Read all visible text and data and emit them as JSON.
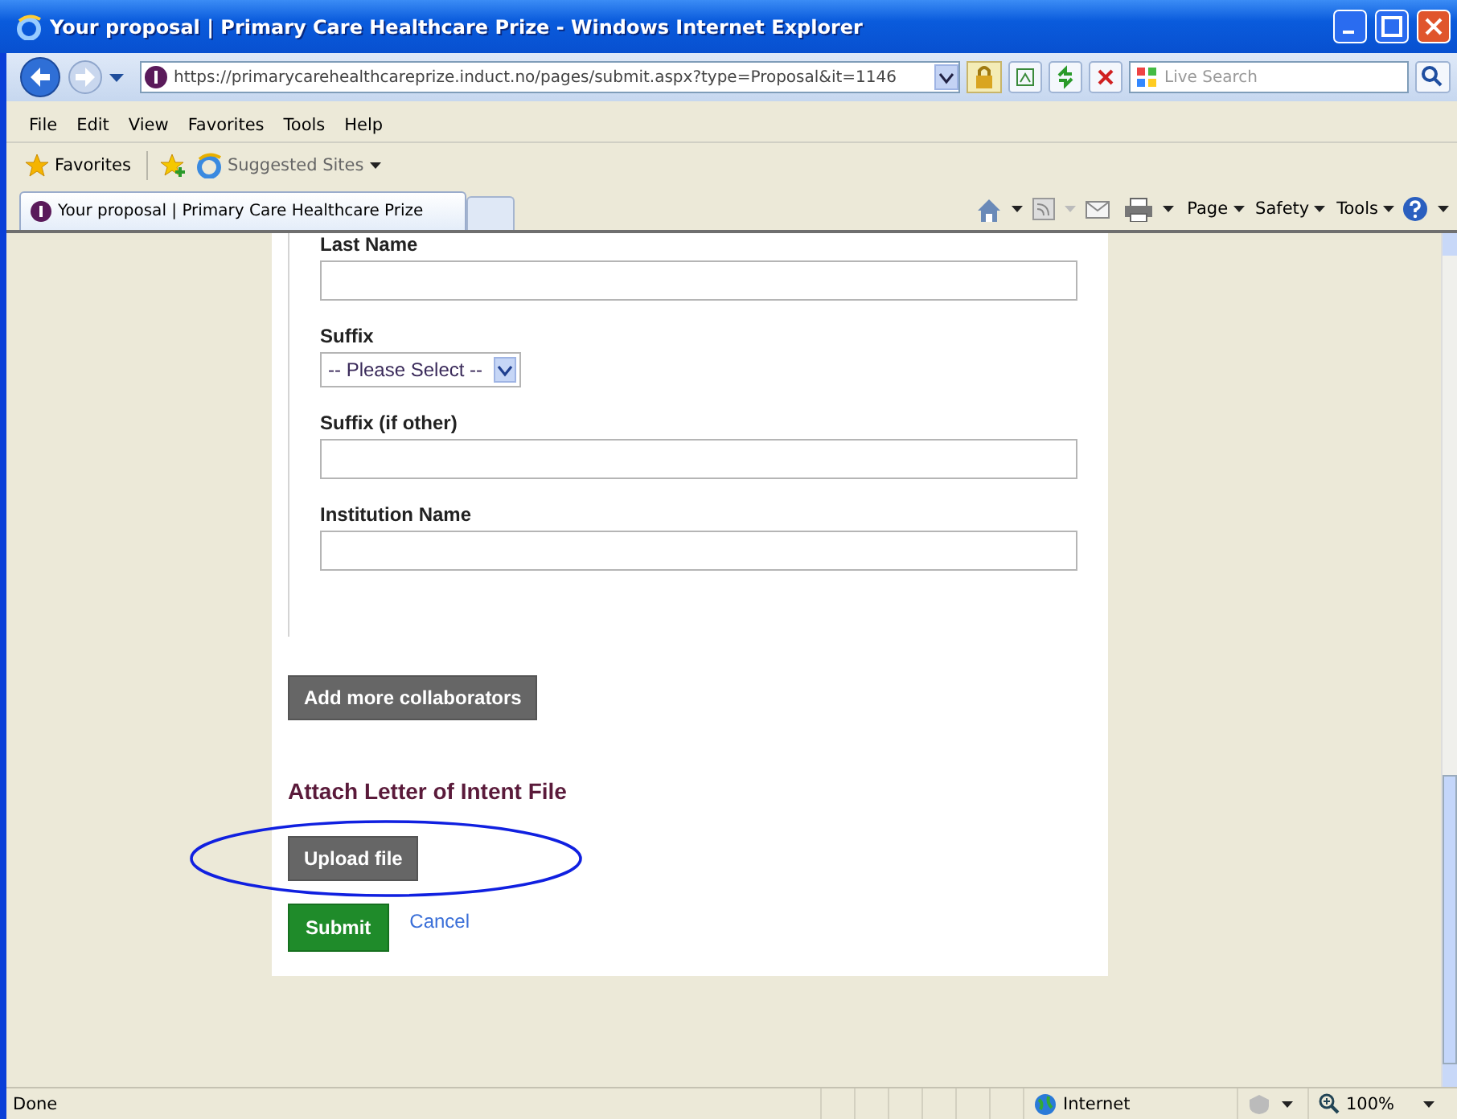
{
  "window": {
    "title": "Your proposal | Primary Care Healthcare Prize - Windows Internet Explorer"
  },
  "address_bar": {
    "url": "https://primarycarehealthcareprize.induct.no/pages/submit.aspx?type=Proposal&it=1146"
  },
  "search": {
    "placeholder": "Live Search"
  },
  "menu": [
    "File",
    "Edit",
    "View",
    "Favorites",
    "Tools",
    "Help"
  ],
  "favorites_bar": {
    "favorites": "Favorites",
    "suggested": "Suggested Sites"
  },
  "tabs": [
    {
      "label": "Your proposal | Primary Care Healthcare Prize",
      "selected": true
    }
  ],
  "command_bar": [
    "Page",
    "Safety",
    "Tools"
  ],
  "form": {
    "fields": [
      {
        "label": "Last Name",
        "kind": "text"
      },
      {
        "label": "Suffix",
        "kind": "select",
        "value": "-- Please Select --"
      },
      {
        "label": "Suffix (if other)",
        "kind": "text"
      },
      {
        "label": "Institution Name",
        "kind": "text"
      }
    ],
    "add_button": "Add more collaborators",
    "attach_heading": "Attach Letter of Intent File",
    "upload_button": "Upload file",
    "submit_button": "Submit",
    "cancel_link": "Cancel"
  },
  "status_bar": {
    "text": "Done",
    "zone": "Internet",
    "zoom": "100%"
  }
}
